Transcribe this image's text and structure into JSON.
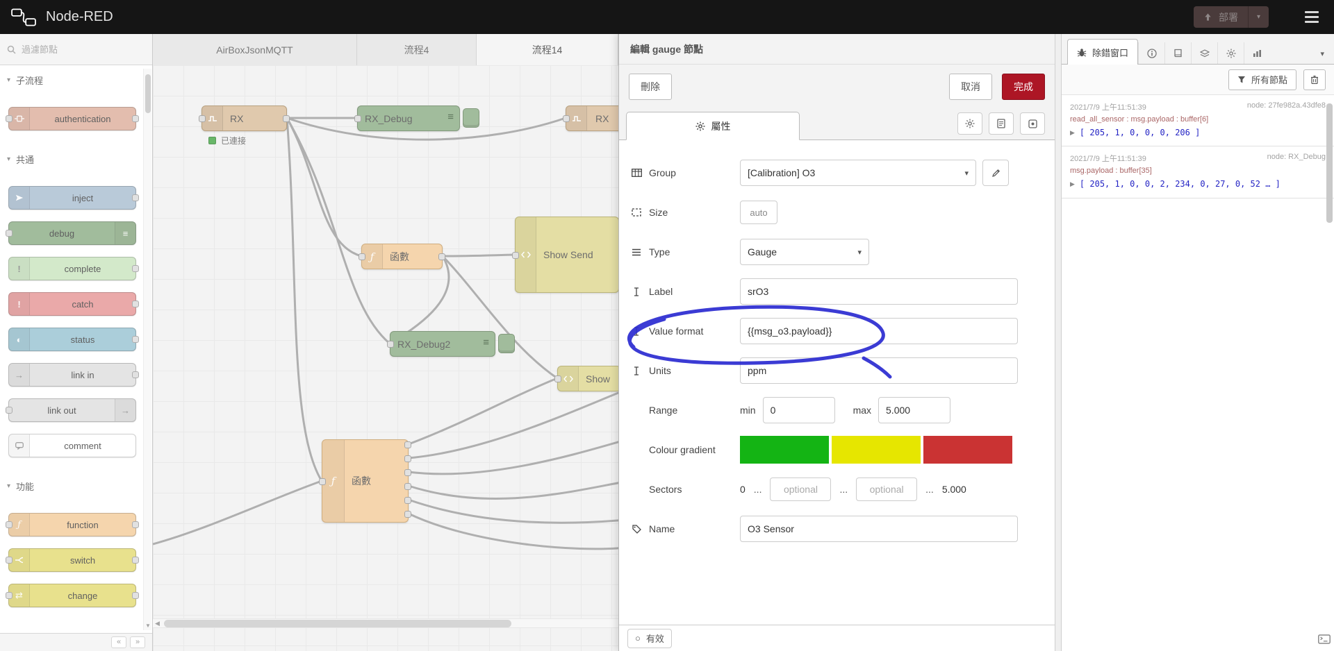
{
  "header": {
    "title": "Node-RED",
    "deploy_label": "部署"
  },
  "palette": {
    "search_placeholder": "過濾節點",
    "sections": [
      {
        "label": "子流程",
        "items": [
          {
            "label": "authentication"
          }
        ]
      },
      {
        "label": "共通",
        "items": [
          {
            "label": "inject"
          },
          {
            "label": "debug"
          },
          {
            "label": "complete"
          },
          {
            "label": "catch"
          },
          {
            "label": "status"
          },
          {
            "label": "link in"
          },
          {
            "label": "link out"
          },
          {
            "label": "comment"
          }
        ]
      },
      {
        "label": "功能",
        "items": [
          {
            "label": "function"
          },
          {
            "label": "switch"
          },
          {
            "label": "change"
          }
        ]
      }
    ]
  },
  "workspace": {
    "tabs": [
      {
        "label": "AirBoxJsonMQTT"
      },
      {
        "label": "流程4"
      },
      {
        "label": "流程14"
      }
    ],
    "nodes": {
      "rx": {
        "label": "RX",
        "status": "已連接"
      },
      "rx_debug": {
        "label": "RX_Debug"
      },
      "rx2": {
        "label": "RX"
      },
      "func1": {
        "label": "函數"
      },
      "show_send": {
        "label": "Show Send"
      },
      "rx_debug2": {
        "label": "RX_Debug2"
      },
      "show2": {
        "label": "Show"
      },
      "func2": {
        "label": "函數"
      }
    }
  },
  "dialog": {
    "title": "編輯 gauge 節點",
    "delete_label": "刪除",
    "cancel_label": "取消",
    "done_label": "完成",
    "properties_tab": "屬性",
    "fields": {
      "group": {
        "label": "Group",
        "value": "[Calibration] O3"
      },
      "size": {
        "label": "Size",
        "value": "auto"
      },
      "type": {
        "label": "Type",
        "value": "Gauge"
      },
      "gauge_label": {
        "label": "Label",
        "value": "srO3"
      },
      "value_format": {
        "label": "Value format",
        "value": "{{msg_o3.payload}}"
      },
      "units": {
        "label": "Units",
        "value": "ppm"
      },
      "range": {
        "label": "Range",
        "min_label": "min",
        "min_value": "0",
        "max_label": "max",
        "max_value": "5.000"
      },
      "colour_gradient": {
        "label": "Colour gradient",
        "colors": [
          "#14b414",
          "#e6e600",
          "#ca3333"
        ]
      },
      "sectors": {
        "label": "Sectors",
        "start": "0",
        "ellipsis": "...",
        "optional_placeholder": "optional",
        "end": "5.000"
      },
      "name": {
        "label": "Name",
        "value": "O3 Sensor"
      }
    },
    "footer": {
      "enabled_label": "有效"
    },
    "accent_color": "#ad1625",
    "annotation_color": "#2a2ad0"
  },
  "sidebar": {
    "debug_tab_label": "除錯窗口",
    "filter_button": "所有節點",
    "messages": [
      {
        "timestamp": "2021/7/9 上午11:51:39",
        "node_id": "node: 27fe982a.43dfe8",
        "property": "read_all_sensor : msg.payload : buffer[6]",
        "payload": "[ 205, 1, 0, 0, 0, 206 ]"
      },
      {
        "timestamp": "2021/7/9 上午11:51:39",
        "node_id": "node: RX_Debug",
        "property": "msg.payload : buffer[35]",
        "payload": "[ 205, 1, 0, 0, 2, 234, 0, 27, 0, 52 … ]"
      }
    ]
  }
}
